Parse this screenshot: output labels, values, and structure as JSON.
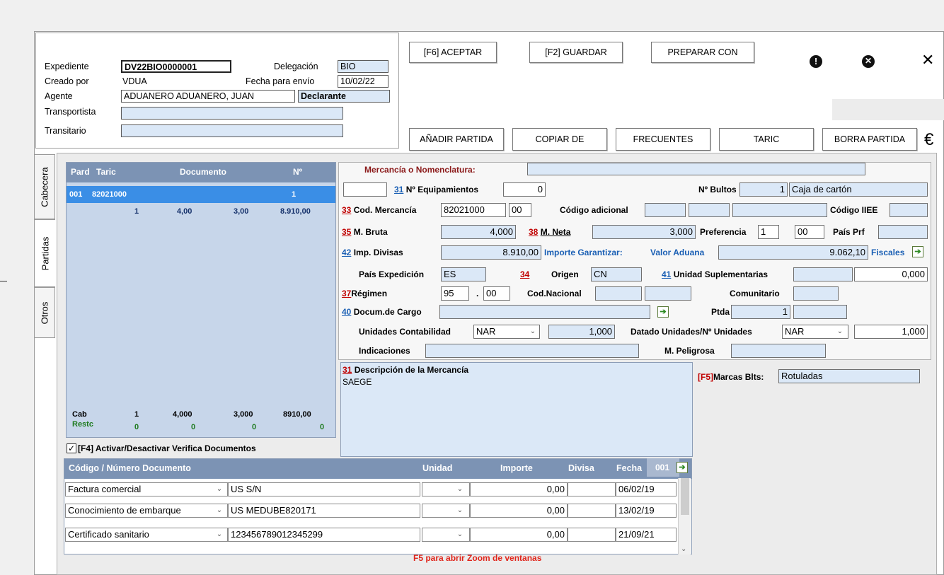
{
  "header": {
    "expediente_label": "Expediente",
    "expediente_value": "DV22BIO0000001",
    "creado_label": "Creado por",
    "creado_value": "VDUA",
    "agente_label": "Agente",
    "agente_value": "ADUANERO ADUANERO, JUAN",
    "declarante_label": "Declarante",
    "transportista_label": "Transportista",
    "transitario_label": "Transitario",
    "delegacion_label": "Delegación",
    "delegacion_value": "BIO",
    "fecha_label": "Fecha para envío",
    "fecha_value": "10/02/22"
  },
  "toolbar": {
    "aceptar": "[F6] ACEPTAR",
    "guardar": "[F2] GUARDAR",
    "preparar": "PREPARAR CON",
    "anadir": "AÑADIR PARTIDA",
    "copiar": "COPIAR DE",
    "frecuentes": "FRECUENTES",
    "taric": "TARIC",
    "borra": "BORRA PARTIDA",
    "euro": "€",
    "close": "✕"
  },
  "tabs": [
    "Cabecera",
    "Partidas",
    "Otros"
  ],
  "list": {
    "headers": [
      "Pard",
      "Taric",
      "Documento",
      "Nº"
    ],
    "selected": {
      "pard": "001",
      "taric": "82021000",
      "n": "1"
    },
    "row": [
      "1",
      "4,00",
      "3,00",
      "8.910,00"
    ],
    "cab_label": "Cab",
    "cab_values": [
      "1",
      "4,000",
      "3,000",
      "8910,00"
    ],
    "resto_label": "Restc",
    "resto_values": [
      "0",
      "0",
      "0",
      "0"
    ]
  },
  "form": {
    "mercancia_label": "Mercancía o Nomenclatura:",
    "n_equip_num": "31",
    "n_equip_label": "Nº Equipamientos",
    "n_equip_value": "0",
    "n_bultos_label": "Nº Bultos",
    "n_bultos_value": "1",
    "bultos_desc": "Caja de cartón",
    "cod_merc_num": "33",
    "cod_merc_label": "Cod. Mercancía",
    "cod_merc_value": "82021000",
    "cod_merc_extra": "00",
    "cod_adic_label": "Código adicional",
    "cod_iiee_label": "Código IIEE",
    "m_bruta_num": "35",
    "m_bruta_label": "M. Bruta",
    "m_bruta_value": "4,000",
    "m_neta_num": "38",
    "m_neta_label": "M. Neta",
    "m_neta_value": "3,000",
    "preferencia_label": "Preferencia",
    "preferencia_value1": "1",
    "preferencia_value2": "00",
    "pais_prf_label": "País Prf",
    "imp_div_num": "42",
    "imp_div_label": "Imp. Divisas",
    "imp_div_value": "8.910,00",
    "importe_garant_label": "Importe Garantizar:",
    "valor_aduana_label": "Valor Aduana",
    "valor_aduana_value": "9.062,10",
    "fiscales_label": "Fiscales",
    "pais_exp_label": "País Expedición",
    "pais_exp_value": "ES",
    "origen_num": "34",
    "origen_label": "Origen",
    "origen_value": "CN",
    "unidad_sup_num": "41",
    "unidad_sup_label": "Unidad Suplementarias",
    "unidad_sup_value": "0,000",
    "regimen_num": "37",
    "regimen_label": "Régimen",
    "regimen_value1": "95",
    "regimen_dot": ".",
    "regimen_value2": "00",
    "cod_nac_label": "Cod.Nacional",
    "comunitario_label": "Comunitario",
    "docum_cargo_num": "40",
    "docum_cargo_label": "Docum.de Cargo",
    "ptda_label": "Ptda",
    "ptda_value": "1",
    "unid_cont_label": "Unidades Contabilidad",
    "unid_cont_value": "NAR",
    "unid_cont_amount": "1,000",
    "datado_label": "Datado Unidades/Nº Unidades",
    "datado_value": "NAR",
    "datado_amount": "1,000",
    "indicaciones_label": "Indicaciones",
    "m_peligrosa_label": "M. Peligrosa",
    "desc_num": "31",
    "desc_label": "Descripción de la Mercancía",
    "desc_value": "SAEGE",
    "marcas_key": "[F5]",
    "marcas_label": "Marcas Blts:",
    "marcas_value": "Rotuladas"
  },
  "verifica": {
    "label": "[F4] Activar/Desactivar Verifica Documentos",
    "checked": true
  },
  "documents": {
    "headers": [
      "Código / Número Documento",
      "Unidad",
      "Importe",
      "Divisa",
      "Fecha",
      "001"
    ],
    "rows": [
      {
        "tipo": "Factura comercial",
        "numero": "US S/N",
        "importe": "0,00",
        "fecha": "06/02/19"
      },
      {
        "tipo": "Conocimiento de embarque",
        "numero": "US MEDUBE820171",
        "importe": "0,00",
        "fecha": "13/02/19"
      },
      {
        "tipo": "Certificado sanitario",
        "numero": "123456789012345299",
        "importe": "0,00",
        "fecha": "21/09/21"
      }
    ]
  },
  "footer": {
    "zoom_hint": "F5 para abrir Zoom de ventanas"
  },
  "colors": {
    "accent": "#3a8ee6",
    "header_blue": "#7c93b4",
    "field_bg": "#dbe8f7",
    "red_label": "#c00000"
  }
}
